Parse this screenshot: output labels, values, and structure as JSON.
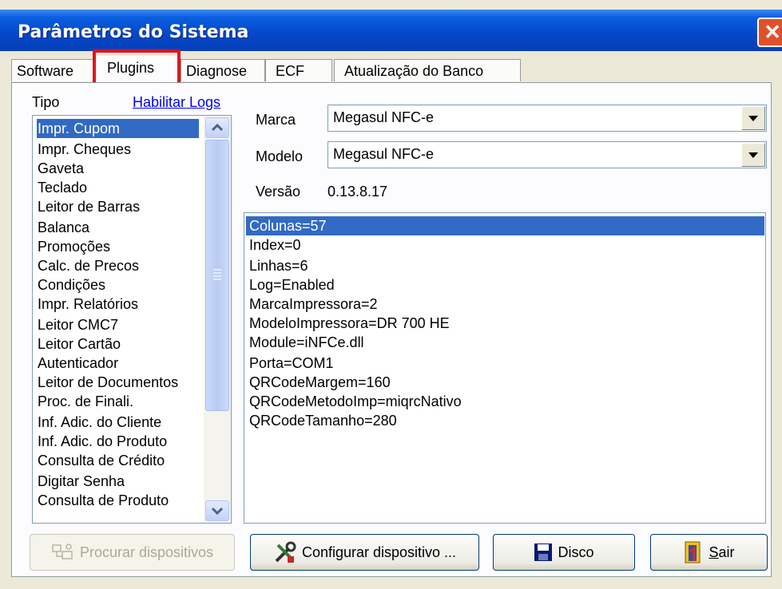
{
  "window": {
    "title": "Parâmetros do Sistema",
    "close_glyph": "✕"
  },
  "tabs": [
    "Software",
    "Plugins",
    "Diagnose",
    "ECF",
    "Atualização do Banco"
  ],
  "tipo_label": "Tipo",
  "habilitar_logs": "Habilitar Logs",
  "tipo_list": {
    "selected": "Impr. Cupom",
    "items": [
      "Impr. Cupom",
      "Impr. Cheques",
      "Gaveta",
      "Teclado",
      "Leitor de Barras",
      "Balanca",
      "Promoções",
      "Calc. de Precos",
      "Condições",
      "Impr. Relatórios",
      "Leitor CMC7",
      "Leitor Cartão",
      "Autenticador",
      "Leitor de Documentos",
      "Proc. de Finali.",
      "Inf. Adic. do Cliente",
      "Inf. Adic. do Produto",
      "Consulta de Crédito",
      "Digitar Senha",
      "Consulta de Produto"
    ]
  },
  "marca": {
    "label": "Marca",
    "value": "Megasul NFC-e"
  },
  "modelo": {
    "label": "Modelo",
    "value": "Megasul NFC-e"
  },
  "versao": {
    "label": "Versão",
    "value": "0.13.8.17"
  },
  "params": {
    "selected": "Colunas=57",
    "lines": [
      "Colunas=57",
      "Index=0",
      "Linhas=6",
      "Log=Enabled",
      "MarcaImpressora=2",
      "ModeloImpressora=DR 700 HE",
      "Module=iNFCe.dll",
      "Porta=COM1",
      "QRCodeMargem=160",
      "QRCodeMetodoImp=miqrcNativo",
      "QRCodeTamanho=280"
    ]
  },
  "buttons": {
    "procurar": "Procurar dispositivos",
    "configurar": "Configurar dispositivo ...",
    "disco": "Disco",
    "sair_mnemonic": "S",
    "sair_rest": "air"
  },
  "colors": {
    "selection": "#316ac5",
    "titlebar": "#0447c8",
    "highlight_box": "#e0141c"
  }
}
